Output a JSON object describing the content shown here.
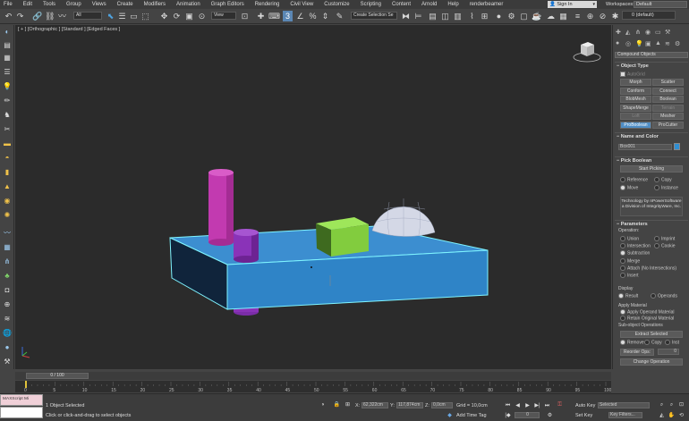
{
  "menu": [
    "File",
    "Edit",
    "Tools",
    "Group",
    "Views",
    "Create",
    "Modifiers",
    "Animation",
    "Graph Editors",
    "Rendering",
    "Civil View",
    "Customize",
    "Scripting",
    "Content",
    "Arnold",
    "Help",
    "renderbeamer"
  ],
  "signin": "Sign In",
  "workspaces_label": "Workspaces:",
  "workspace": "Default",
  "toolbar": {
    "filter": "All",
    "ref_coord": "View",
    "selection_set": "Create Selection Se",
    "layer": "0 (default)"
  },
  "viewport": {
    "label": "[ + ] [Orthographic ] [Standard ] [Edged Faces ]"
  },
  "panel": {
    "category": "Compound Objects",
    "object_type": {
      "title": "Object Type",
      "autogrid": "AutoGrid",
      "buttons": [
        {
          "label": "Morph",
          "state": "normal"
        },
        {
          "label": "Scatter",
          "state": "normal"
        },
        {
          "label": "Conform",
          "state": "normal"
        },
        {
          "label": "Connect",
          "state": "normal"
        },
        {
          "label": "BlobMesh",
          "state": "normal"
        },
        {
          "label": "Boolean",
          "state": "normal"
        },
        {
          "label": "ShapeMerge",
          "state": "normal"
        },
        {
          "label": "Terrain",
          "state": "disabled"
        },
        {
          "label": "Loft",
          "state": "disabled"
        },
        {
          "label": "Mesher",
          "state": "normal"
        },
        {
          "label": "ProBoolean",
          "state": "active"
        },
        {
          "label": "ProCutter",
          "state": "normal"
        }
      ]
    },
    "name_color": {
      "title": "Name and Color",
      "name": "Box001",
      "color": "#2f8fd3"
    },
    "pick_boolean": {
      "title": "Pick Boolean",
      "start_button": "Start Picking",
      "options": [
        "Reference",
        "Copy",
        "Move",
        "Instance"
      ]
    },
    "credit": "Technology by nPowerSoftware a Division of IntegrityWare, Inc.",
    "parameters": {
      "title": "Parameters",
      "operation_label": "Operation:",
      "ops": [
        "Union",
        "Imprint",
        "Intersection",
        "Cookie",
        "Subtraction",
        "Merge",
        "Attach (No Intersections)",
        "Insert"
      ],
      "display_label": "Display",
      "display_opts": [
        "Result",
        "Operands"
      ],
      "apply_material_label": "Apply Material",
      "material_opts": [
        "Apply Operand Material",
        "Retain Original Material"
      ],
      "subobj_label": "Sub-object Operations",
      "extract_button": "Extract Selected",
      "extract_opts": [
        "Remove",
        "Copy",
        "Inst"
      ],
      "reorder_button": "Reorder Ops:",
      "reorder_value": "0",
      "change_op_button": "Change Operation"
    }
  },
  "timeslider": "0 / 100",
  "ruler_ticks": [
    "0",
    "5",
    "10",
    "15",
    "20",
    "25",
    "30",
    "35",
    "40",
    "45",
    "50",
    "55",
    "60",
    "65",
    "70",
    "75",
    "80",
    "85",
    "90",
    "95",
    "100"
  ],
  "status": {
    "maxscript": "MAXScript Mi",
    "selected": "1 Object Selected",
    "prompt": "Click or click-and-drag to select objects",
    "x_label": "X:",
    "x_value": "62,322cm",
    "y_label": "Y:",
    "y_value": "117,874cm",
    "z_label": "Z:",
    "z_value": "0,0cm",
    "grid": "Grid = 10,0cm",
    "add_time_tag": "Add Time Tag",
    "frame": "0",
    "auto_key": "Auto Key",
    "set_key": "Set Key",
    "selected_dd": "Selected",
    "key_filters": "Key Filters..."
  },
  "colors": {
    "accent": "#4f8dc4",
    "selection": "#7ff4ff"
  }
}
